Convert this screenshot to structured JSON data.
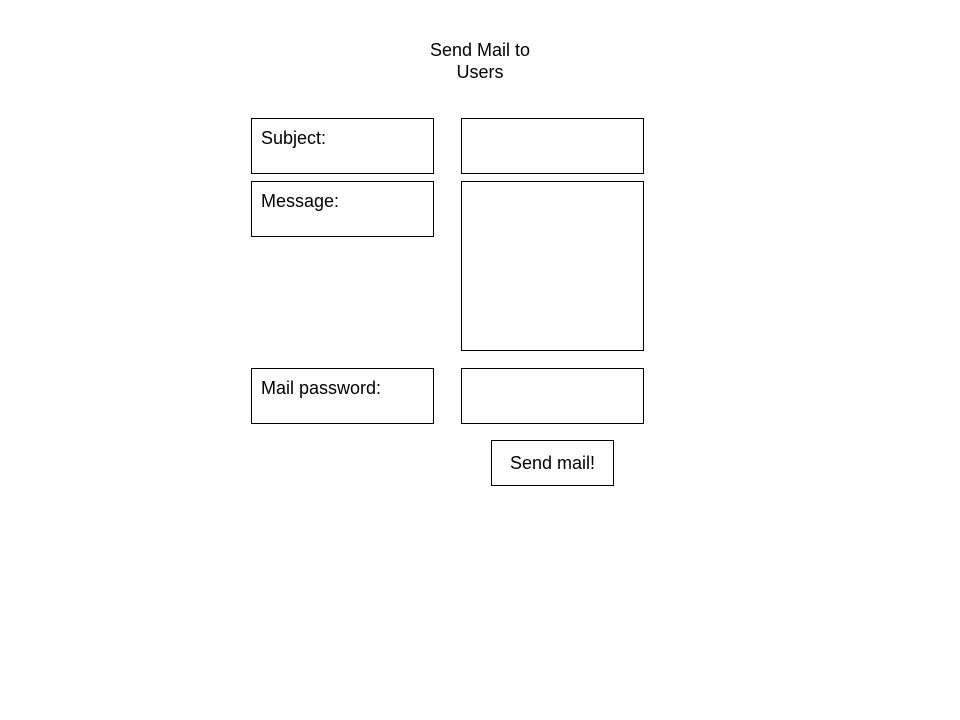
{
  "title": {
    "line1": "Send Mail to",
    "line2": "Users"
  },
  "form": {
    "subject_label": "Subject:",
    "message_label": "Message:",
    "password_label": "Mail password:",
    "subject_value": "",
    "message_value": "",
    "password_value": ""
  },
  "actions": {
    "send_label": "Send mail!"
  },
  "colors": {
    "background": "#ffffff",
    "border": "#000000",
    "text": "#000000"
  }
}
